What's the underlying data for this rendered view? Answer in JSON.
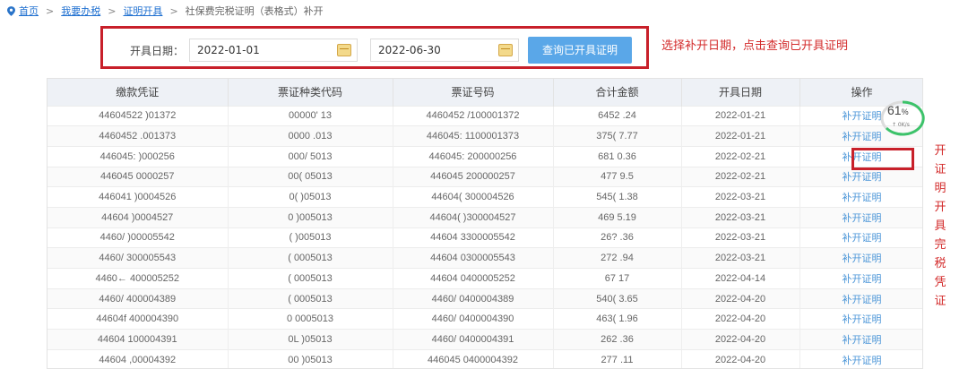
{
  "breadcrumb": {
    "home": "首页",
    "separator": ">",
    "items": [
      "我要办税",
      "证明开具",
      "社保费完税证明（表格式）补开"
    ]
  },
  "query": {
    "label": "开具日期：",
    "start_date": "2022-01-01",
    "dash": "—",
    "end_date": "2022-06-30",
    "button": "查询已开具证明"
  },
  "hint": "选择补开日期，点击查询已开具证明",
  "table": {
    "headers": [
      "缴款凭证",
      "票证种类代码",
      "票证号码",
      "合计金额",
      "开具日期",
      "操作"
    ],
    "rows": [
      [
        "44604522  )01372",
        "00000'  13",
        "4460452  /100001372",
        "6452  .24",
        "2022-01-21",
        "补开证明"
      ],
      [
        "4460452  .001373",
        "0000  .013",
        "446045:  1100001373",
        "375(  7.77",
        "2022-01-21",
        "补开证明"
      ],
      [
        "446045:  )000256",
        "000/  5013",
        "446045:  200000256",
        "681  0.36",
        "2022-02-21",
        "补开证明"
      ],
      [
        "446045  0000257",
        "00(  05013",
        "446045  200000257",
        "477  9.5",
        "2022-02-21",
        "补开证明"
      ],
      [
        "446041  )0004526",
        "0(  )05013",
        "44604(  300004526",
        "545(  1.38",
        "2022-03-21",
        "补开证明"
      ],
      [
        "44604  )0004527",
        "0  )005013",
        "44604(  )300004527",
        "469  5.19",
        "2022-03-21",
        "补开证明"
      ],
      [
        "4460/  )00005542",
        "(  )005013",
        "44604  3300005542",
        "26?  .36",
        "2022-03-21",
        "补开证明"
      ],
      [
        "4460/  300005543",
        "(  0005013",
        "44604  0300005543",
        "272  .94",
        "2022-03-21",
        "补开证明"
      ],
      [
        "4460←  400005252",
        "(  0005013",
        "44604  0400005252",
        "67  17",
        "2022-04-14",
        "补开证明"
      ],
      [
        "4460/  400004389",
        "(  0005013",
        "4460/  0400004389",
        "540(  3.65",
        "2022-04-20",
        "补开证明"
      ],
      [
        "44604f  400004390",
        "0  0005013",
        "4460/  0400004390",
        "463(  1.96",
        "2022-04-20",
        "补开证明"
      ],
      [
        "44604  100004391",
        "0L  )05013",
        "4460/  0400004391",
        "262  .36",
        "2022-04-20",
        "补开证明"
      ],
      [
        "44604  ,00004392",
        "00  )05013",
        "446045  0400004392",
        "277  .11",
        "2022-04-20",
        "补开证明"
      ]
    ]
  },
  "side_note": [
    "开",
    "证",
    "明",
    "开",
    "具",
    "完",
    "税",
    "凭",
    "证"
  ],
  "gauge": {
    "percent": "61",
    "percent_sign": "%",
    "speed": "↑ 0K/s"
  },
  "colors": {
    "annotation_red": "#c8202a",
    "button_blue": "#5aa7e8",
    "link_blue": "#4a95d8",
    "gauge_green": "#3cc36a"
  }
}
